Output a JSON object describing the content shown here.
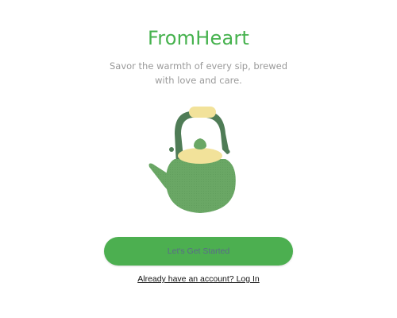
{
  "app": {
    "title": "FromHeart",
    "tagline": "Savor the warmth of every sip, brewed with love and care."
  },
  "illustration": {
    "icon": "teapot-icon",
    "body_color": "#6aa765",
    "lid_color": "#f2e29a",
    "handle_color": "#4f7c56"
  },
  "actions": {
    "get_started_label": "Let's Get Started",
    "login_prompt": "Already have an account? Log In"
  },
  "colors": {
    "accent": "#46b24e",
    "button_bg": "#4caf50"
  }
}
